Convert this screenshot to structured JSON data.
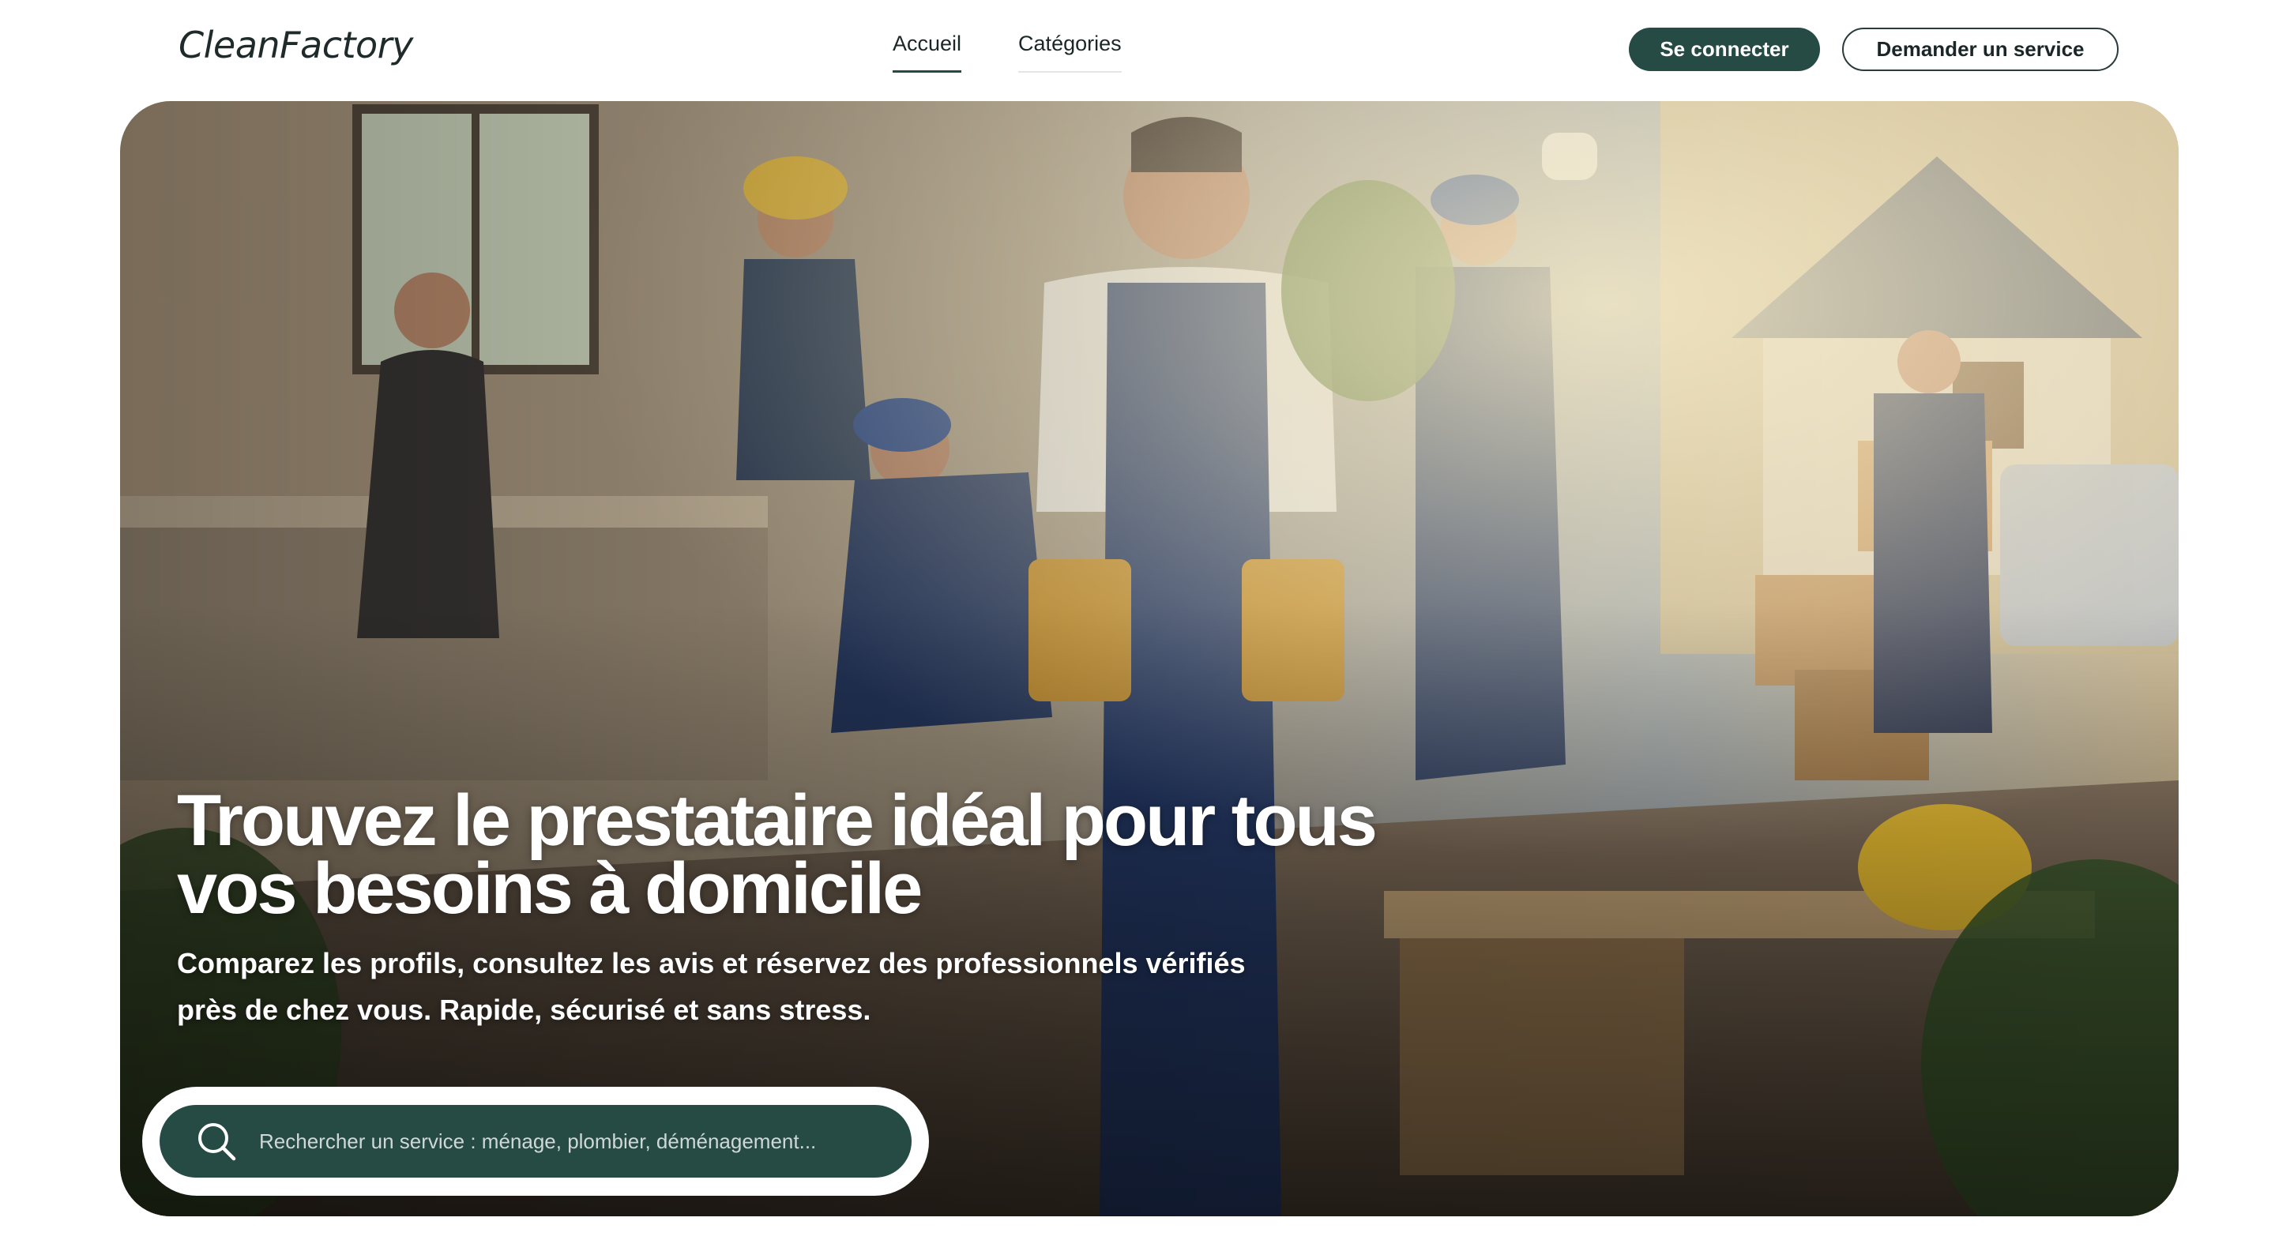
{
  "brand": {
    "logo_text": "CleanFactory"
  },
  "nav": {
    "tabs": [
      {
        "label": "Accueil",
        "active": true
      },
      {
        "label": "Catégories",
        "active": false
      }
    ]
  },
  "header_actions": {
    "login_label": "Se connecter",
    "request_label": "Demander un service"
  },
  "hero": {
    "title_line1": "Trouvez le prestataire idéal pour tous",
    "title_line2": "vos besoins à domicile",
    "subtitle_line1": "Comparez les profils, consultez les avis et réservez des professionnels vérifiés",
    "subtitle_line2": "près de chez vous. Rapide, sécurisé et sans stress.",
    "image": "hero-photo-home-service-workers"
  },
  "search": {
    "placeholder": "Rechercher un service : ménage, plombier, déménagement...",
    "value": "",
    "icon": "search-icon"
  },
  "colors": {
    "primary": "#264a44",
    "text_dark": "#1b2626",
    "background": "#ffffff",
    "white": "#ffffff"
  }
}
